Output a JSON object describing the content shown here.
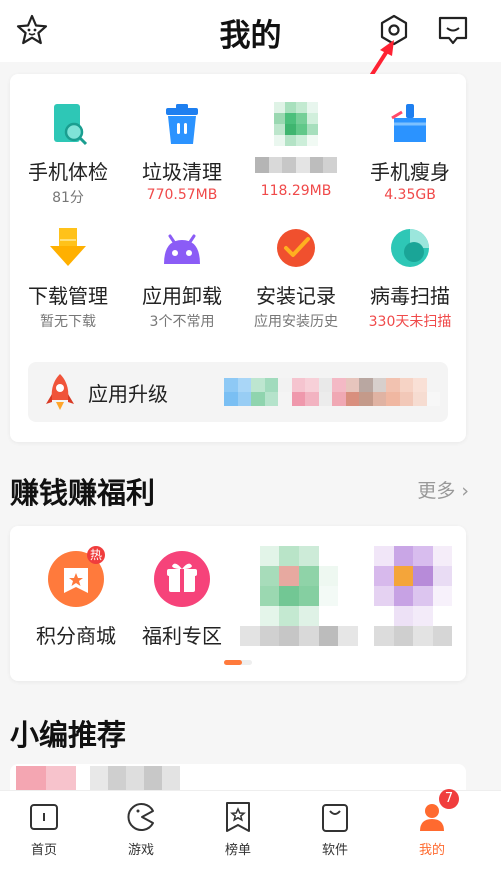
{
  "header": {
    "title": "我的"
  },
  "tools": [
    {
      "name": "手机体检",
      "sub": "81分"
    },
    {
      "name": "垃圾清理",
      "sub": "770.57MB"
    },
    {
      "name": "",
      "sub": "118.29MB"
    },
    {
      "name": "手机瘦身",
      "sub": "4.35GB"
    },
    {
      "name": "下载管理",
      "sub": "暂无下载"
    },
    {
      "name": "应用卸载",
      "sub": "3个不常用"
    },
    {
      "name": "安装记录",
      "sub": "应用安装历史"
    },
    {
      "name": "病毒扫描",
      "sub": "330天未扫描"
    }
  ],
  "upgrade": {
    "label": "应用升级"
  },
  "welfare": {
    "title": "赚钱赚福利",
    "more": "更多",
    "items": [
      {
        "label": "积分商城",
        "badge": "热"
      },
      {
        "label": "福利专区"
      }
    ]
  },
  "recommend": {
    "title": "小编推荐"
  },
  "tabbar": {
    "tabs": [
      {
        "label": "首页",
        "icon": "home-icon"
      },
      {
        "label": "游戏",
        "icon": "pacman-icon"
      },
      {
        "label": "榜单",
        "icon": "ranking-icon"
      },
      {
        "label": "软件",
        "icon": "bag-icon"
      },
      {
        "label": "我的",
        "icon": "profile-icon",
        "badge": "7",
        "active": true
      }
    ]
  },
  "colors": {
    "accent": "#ff6a2f",
    "alert": "#f04a4a"
  }
}
